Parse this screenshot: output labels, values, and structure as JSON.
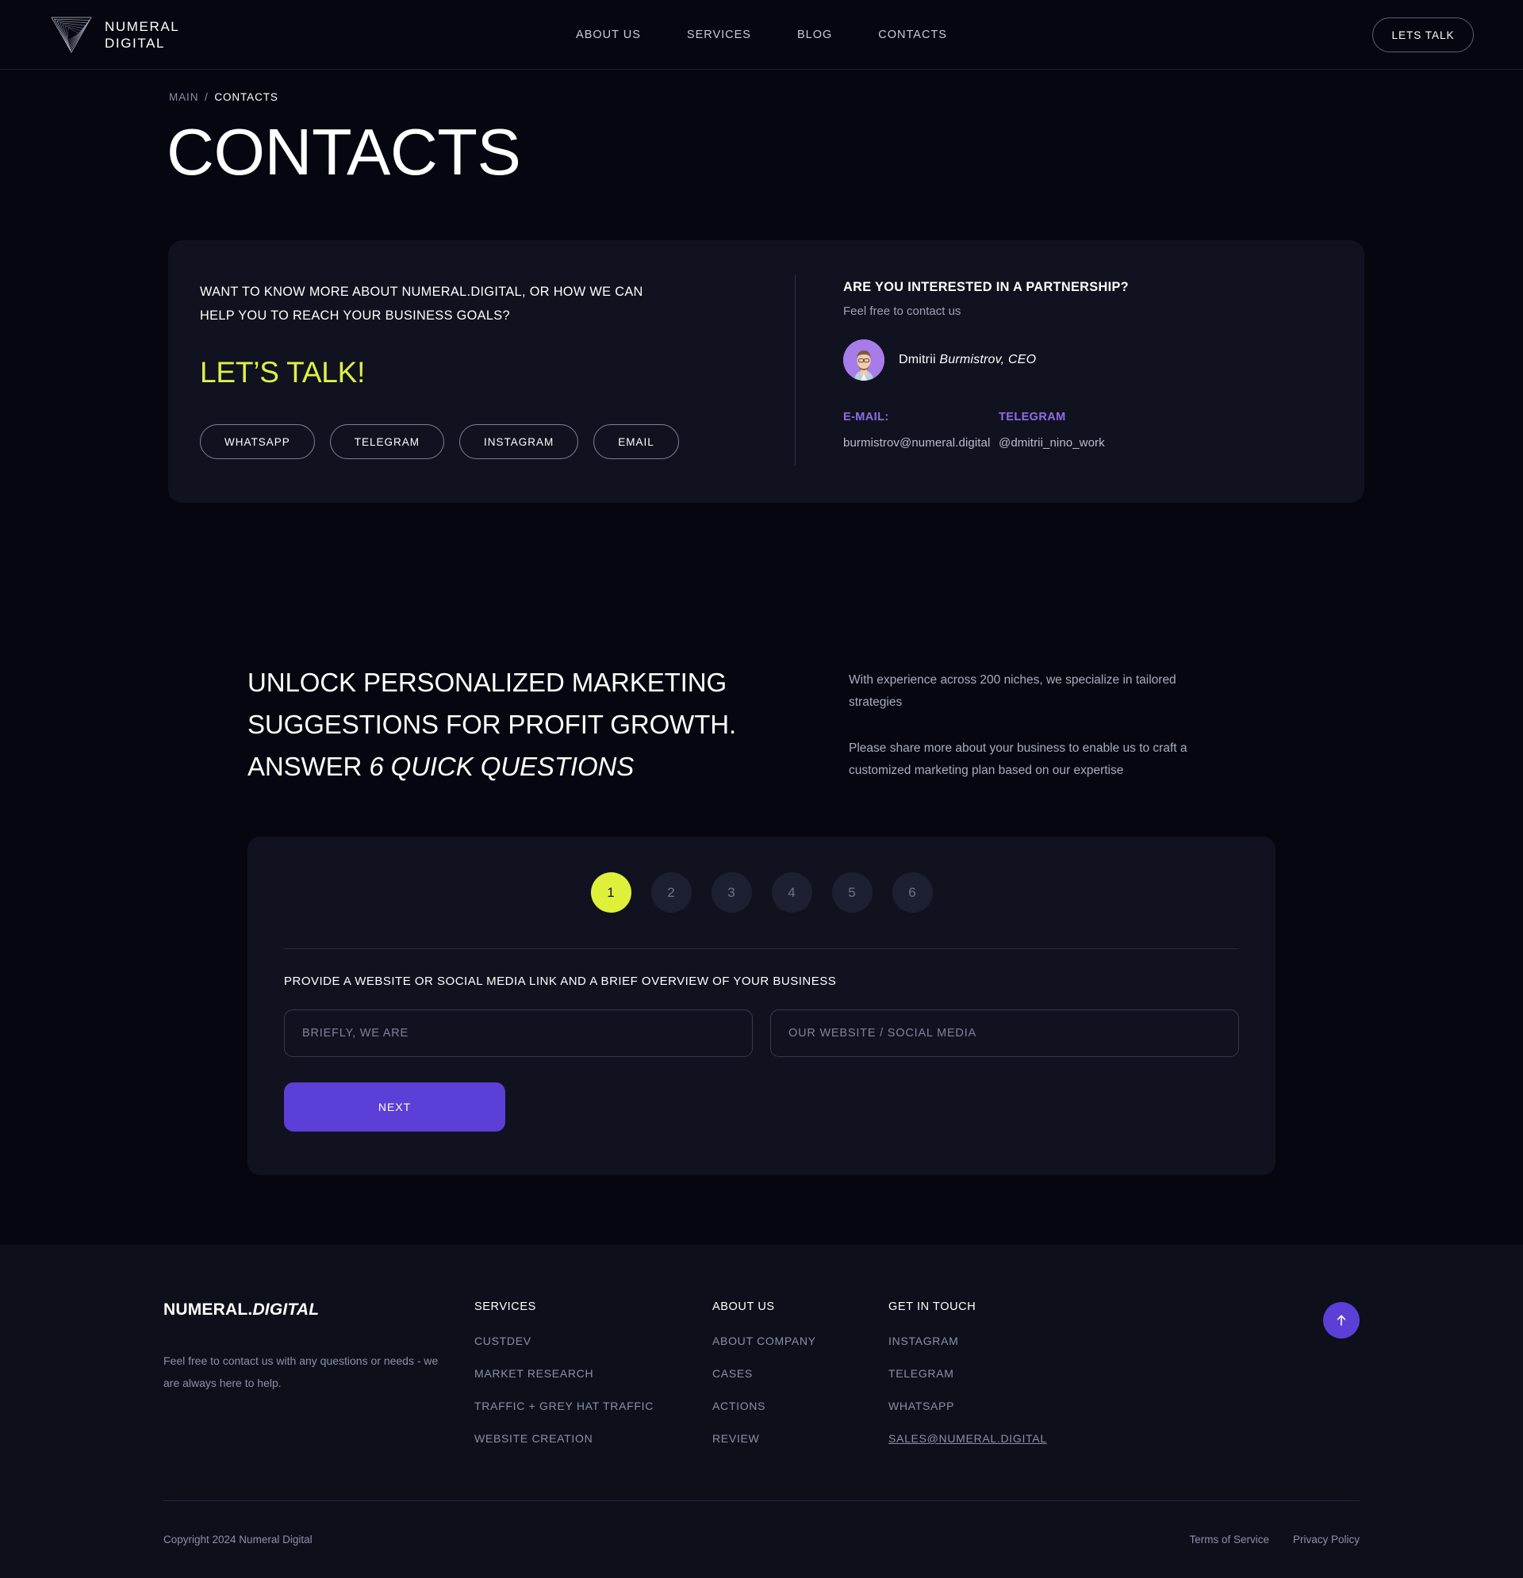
{
  "header": {
    "logo": {
      "icon": "numeral-triangle-vortex-logo",
      "line1": "NUMERAL",
      "line2": "DIGITAL",
      "text": "NUMERAL\nDIGITAL"
    },
    "nav": [
      {
        "label": "ABOUT US"
      },
      {
        "label": "SERVICES"
      },
      {
        "label": "BLOG"
      },
      {
        "label": "CONTACTS"
      }
    ],
    "cta_label": "LETS TALK"
  },
  "breadcrumb": {
    "main": "MAIN",
    "separator": "/",
    "current": "CONTACTS"
  },
  "page_title": "CONTACTS",
  "contact_card": {
    "headline": "WANT TO KNOW MORE ABOUT NUMERAL.DIGITAL, OR HOW WE CAN HELP YOU TO REACH YOUR BUSINESS GOALS?",
    "lets_talk": "LET’S TALK!",
    "lets_talk_color": "#dff048",
    "social_buttons": [
      {
        "label": "WHATSAPP"
      },
      {
        "label": "TELEGRAM"
      },
      {
        "label": "INSTAGRAM"
      },
      {
        "label": "EMAIL"
      }
    ],
    "partnership": {
      "title": "ARE YOU INTERESTED IN A PARTNERSHIP?",
      "subtitle": "Feel free to contact us",
      "person": {
        "avatar_icon": "person-avatar-photo",
        "first_name": "Dmitrii",
        "last_role": "Burmistrov, CEO"
      },
      "email": {
        "label": "E-MAIL:",
        "value": "burmistrov@numeral.digital"
      },
      "telegram": {
        "label": "TELEGRAM",
        "value": "@dmitrii_nino_work"
      },
      "label_color": "#8e6ee8"
    }
  },
  "quiz": {
    "headline_line1": "UNLOCK PERSONALIZED MARKETING",
    "headline_line2": "SUGGESTIONS FOR PROFIT GROWTH.",
    "headline_line3_plain": "ANSWER ",
    "headline_line3_italic": "6 QUICK QUESTIONS",
    "description_1": "With experience across 200 niches, we specialize in tailored strategies",
    "description_2": "Please share more about your business to enable us to craft a customized marketing plan based on our expertise",
    "steps": [
      {
        "label": "1",
        "active": true
      },
      {
        "label": "2",
        "active": false
      },
      {
        "label": "3",
        "active": false
      },
      {
        "label": "4",
        "active": false
      },
      {
        "label": "5",
        "active": false
      },
      {
        "label": "6",
        "active": false
      }
    ],
    "active_step_color": "#dff03a",
    "question": "PROVIDE A WEBSITE OR SOCIAL MEDIA LINK AND A BRIEF OVERVIEW OF YOUR BUSINESS",
    "input_brief": {
      "value": "",
      "placeholder": "BRIEFLY, WE ARE"
    },
    "input_website": {
      "value": "",
      "placeholder": "OUR WEBSITE / SOCIAL MEDIA"
    },
    "next_label": "NEXT",
    "next_color": "#5b3fd6"
  },
  "footer": {
    "brand_plain": "NUMERAL.",
    "brand_italic": "DIGITAL",
    "brand_desc": "Feel free to contact us with any questions or needs - we are always here to help.",
    "columns": [
      {
        "title": "SERVICES",
        "links": [
          {
            "label": "CUSTDEV"
          },
          {
            "label": "MARKET RESEARCH"
          },
          {
            "label": "TRAFFIC + GREY HAT TRAFFIC"
          },
          {
            "label": "WEBSITE CREATION"
          }
        ]
      },
      {
        "title": "ABOUT US",
        "links": [
          {
            "label": "ABOUT COMPANY"
          },
          {
            "label": "CASES"
          },
          {
            "label": "ACTIONS"
          },
          {
            "label": "REVIEW"
          }
        ]
      },
      {
        "title": "GET IN TOUCH",
        "links": [
          {
            "label": "INSTAGRAM"
          },
          {
            "label": "TELEGRAM"
          },
          {
            "label": "WHATSAPP"
          },
          {
            "label": "SALES@NUMERAL.DIGITAL",
            "underline": true
          }
        ]
      }
    ],
    "scroll_top_icon": "arrow-up-icon",
    "copyright": "Copyright 2024 Numeral Digital",
    "legal": [
      {
        "label": "Terms of Service"
      },
      {
        "label": "Privacy Policy"
      }
    ]
  }
}
